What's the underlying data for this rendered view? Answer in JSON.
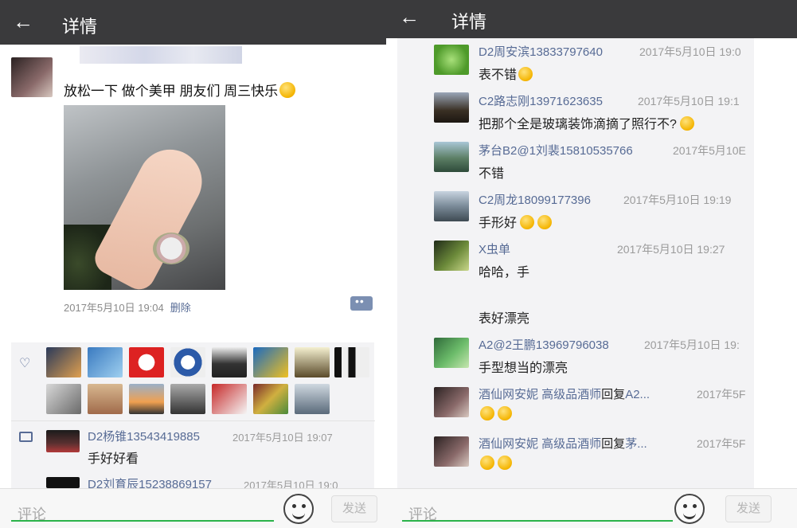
{
  "left": {
    "header": {
      "back_icon": "←",
      "title": "详情"
    },
    "post": {
      "text": "放松一下 做个美甲 朋友们 周三快乐",
      "time": "2017年5月10日 19:04",
      "delete_label": "删除"
    },
    "comments": [
      {
        "name": "D2杨锥13543419885",
        "time": "2017年5月10日 19:07",
        "text": "手好好看"
      },
      {
        "name": "D2刘育辰15238869157",
        "time": "2017年5月10日 19:0",
        "text": ""
      }
    ],
    "input": {
      "placeholder": "评论",
      "send_label": "发送"
    }
  },
  "right": {
    "header": {
      "back_icon": "←",
      "title": "详情"
    },
    "comments": [
      {
        "name": "D2周安滨13833797640",
        "time": "2017年5月10日 19:0",
        "text": "表不错"
      },
      {
        "name": "C2路志刚13971623635",
        "time": "2017年5月10日 19:1",
        "text": "把那个全是玻璃装饰滴摘了照行不?"
      },
      {
        "name": "茅台B2@1刘裴15810535766",
        "time": "2017年5月10E",
        "text": "不错"
      },
      {
        "name": "C2周龙18099177396",
        "time": "2017年5月10日 19:19",
        "text": "手形好"
      },
      {
        "name": "X虫单",
        "time": "2017年5月10日 19:27",
        "text": "哈哈，手",
        "text2": "表好漂亮"
      },
      {
        "name": "A2@2王鹏13969796038",
        "time": "2017年5月10日 19:",
        "text": "手型想当的漂亮"
      },
      {
        "name": "酒仙网安妮 高级品酒师",
        "reply_label": "回复",
        "reply_to": "A2...",
        "time": "2017年5F",
        "text": ""
      },
      {
        "name": "酒仙网安妮 高级品酒师",
        "reply_label": "回复",
        "reply_to": "茅...",
        "time": "2017年5F",
        "text": ""
      }
    ],
    "input": {
      "placeholder": "评论",
      "send_label": "发送"
    }
  },
  "colors": {
    "link": "#576b95",
    "topbar": "#3a3a3c",
    "accent": "#2bb34a"
  },
  "icons": [
    "back-arrow-icon",
    "heart-icon",
    "comment-bubble-icon",
    "emoji-face-icon",
    "more-comment-icon"
  ]
}
